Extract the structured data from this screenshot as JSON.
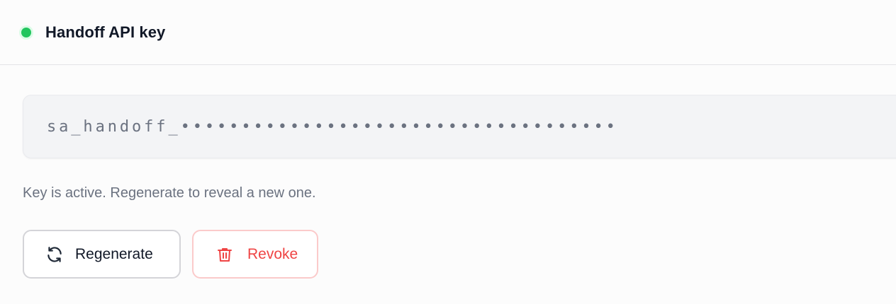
{
  "header": {
    "title": "Handoff API key",
    "status": "active",
    "status_color": "#22c55e"
  },
  "key": {
    "value": "sa_handoff_••••••••••••••••••••••••••••••••••••"
  },
  "helper_text": "Key is active. Regenerate to reveal a new one.",
  "actions": {
    "regenerate": {
      "label": "Regenerate",
      "icon": "refresh-icon"
    },
    "revoke": {
      "label": "Revoke",
      "icon": "trash-icon",
      "color": "#ef4444"
    }
  }
}
